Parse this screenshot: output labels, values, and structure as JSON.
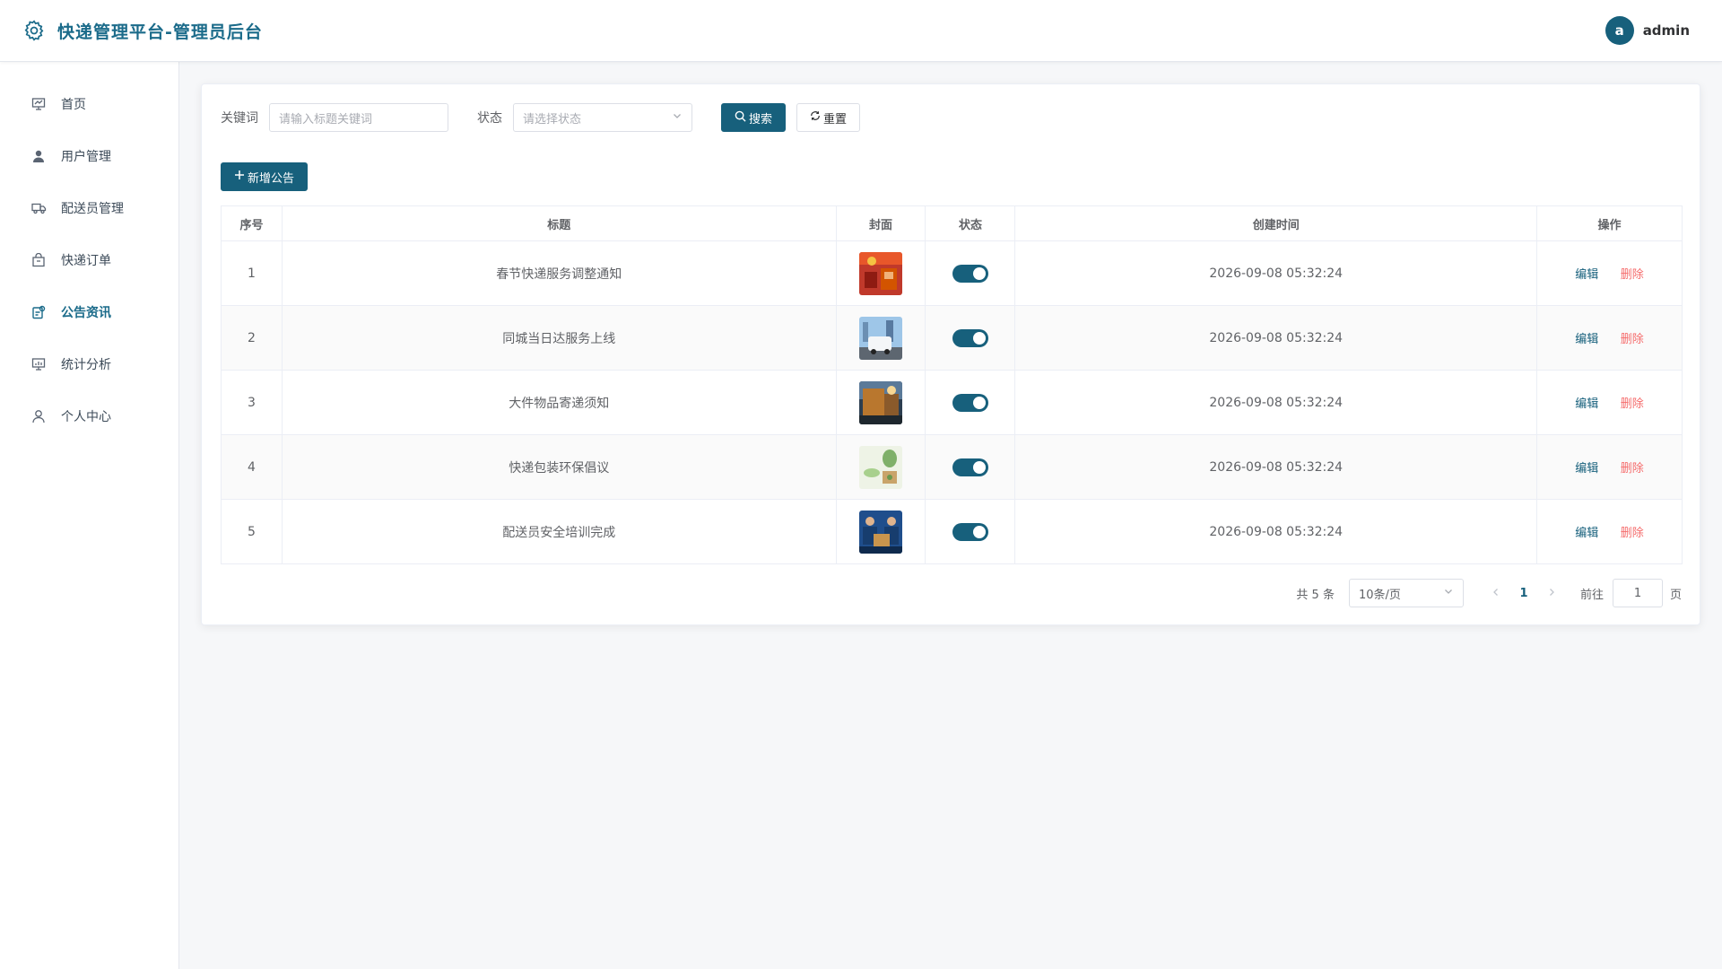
{
  "header": {
    "title": "快递管理平台-管理员后台",
    "avatar_letter": "a",
    "username": "admin"
  },
  "sidebar": {
    "items": [
      {
        "label": "首页",
        "icon": "monitor-icon"
      },
      {
        "label": "用户管理",
        "icon": "user-icon"
      },
      {
        "label": "配送员管理",
        "icon": "truck-icon"
      },
      {
        "label": "快递订单",
        "icon": "box-icon"
      },
      {
        "label": "公告资讯",
        "icon": "notice-icon",
        "active": true
      },
      {
        "label": "统计分析",
        "icon": "chart-icon"
      },
      {
        "label": "个人中心",
        "icon": "person-icon"
      }
    ]
  },
  "filters": {
    "keyword_label": "关键词",
    "keyword_placeholder": "请输入标题关键词",
    "status_label": "状态",
    "status_placeholder": "请选择状态",
    "search_label": "搜索",
    "reset_label": "重置"
  },
  "add_button_label": "新增公告",
  "table": {
    "columns": [
      "序号",
      "标题",
      "封面",
      "状态",
      "创建时间",
      "操作"
    ],
    "rows": [
      {
        "index": "1",
        "title": "春节快递服务调整通知",
        "created": "2026-09-08 05:32:24",
        "status_on": true
      },
      {
        "index": "2",
        "title": "同城当日达服务上线",
        "created": "2026-09-08 05:32:24",
        "status_on": true
      },
      {
        "index": "3",
        "title": "大件物品寄递须知",
        "created": "2026-09-08 05:32:24",
        "status_on": true
      },
      {
        "index": "4",
        "title": "快递包装环保倡议",
        "created": "2026-09-08 05:32:24",
        "status_on": true
      },
      {
        "index": "5",
        "title": "配送员安全培训完成",
        "created": "2026-09-08 05:32:24",
        "status_on": true
      }
    ],
    "edit_label": "编辑",
    "delete_label": "删除"
  },
  "pagination": {
    "total_text": "共 5 条",
    "page_size": "10条/页",
    "current_page": "1",
    "goto_label": "前往",
    "goto_value": "1",
    "page_suffix": "页"
  },
  "colors": {
    "primary": "#17607c",
    "danger": "#f56c6c"
  }
}
